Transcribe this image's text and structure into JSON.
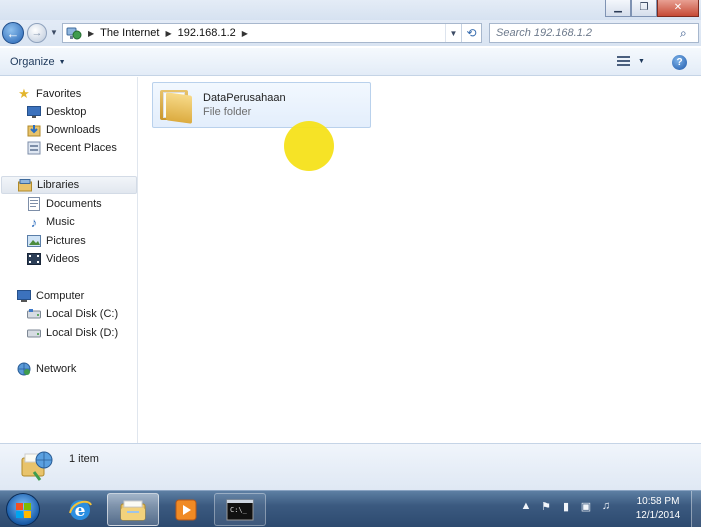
{
  "window": {
    "caption_buttons": {
      "minimize": "minimize-icon",
      "maximize": "maximize-icon",
      "close": "close-icon"
    }
  },
  "address_bar": {
    "breadcrumbs": [
      "The Internet",
      "192.168.1.2"
    ],
    "search_placeholder": "Search 192.168.1.2"
  },
  "toolbar": {
    "organize_label": "Organize",
    "help_glyph": "?"
  },
  "nav_pane": {
    "favorites": {
      "label": "Favorites",
      "items": [
        {
          "label": "Desktop",
          "icon": "desktop-icon"
        },
        {
          "label": "Downloads",
          "icon": "downloads-icon"
        },
        {
          "label": "Recent Places",
          "icon": "recent-places-icon"
        }
      ]
    },
    "libraries": {
      "label": "Libraries",
      "items": [
        {
          "label": "Documents",
          "icon": "documents-icon"
        },
        {
          "label": "Music",
          "icon": "music-icon"
        },
        {
          "label": "Pictures",
          "icon": "pictures-icon"
        },
        {
          "label": "Videos",
          "icon": "videos-icon"
        }
      ]
    },
    "computer": {
      "label": "Computer",
      "items": [
        {
          "label": "Local Disk (C:)",
          "icon": "drive-c-icon"
        },
        {
          "label": "Local Disk (D:)",
          "icon": "drive-d-icon"
        }
      ]
    },
    "network": {
      "label": "Network"
    }
  },
  "content": {
    "items": [
      {
        "name": "DataPerusahaan",
        "type": "File folder"
      }
    ]
  },
  "details": {
    "count": "1 item"
  },
  "taskbar": {
    "pinned": [
      "internet-explorer-icon",
      "windows-explorer-icon",
      "media-player-icon",
      "command-prompt-icon"
    ],
    "clock_time": "10:58 PM",
    "clock_date": "12/1/2014"
  },
  "colors": {
    "highlight_dot": "#f5e21a",
    "taskbar": "#3b5a80",
    "selection_border": "#b9d1ec"
  }
}
